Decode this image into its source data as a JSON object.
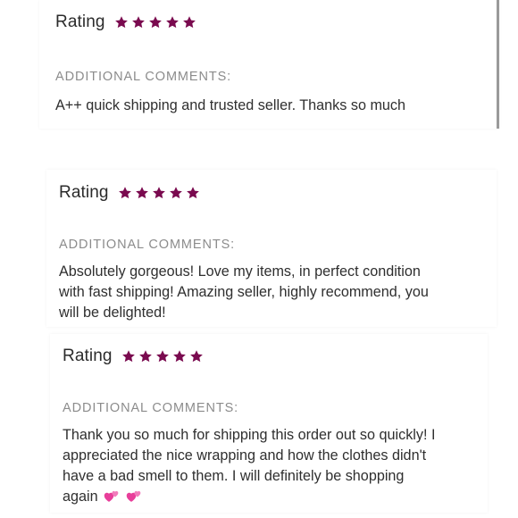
{
  "colors": {
    "star": "#7a0a4f",
    "heart": "#e83e9a",
    "label": "#8c8c8c",
    "text": "#2f2f2f"
  },
  "reviews": [
    {
      "rating_label": "Rating",
      "stars": 5,
      "comments_label": "ADDITIONAL COMMENTS:",
      "comment": "A++ quick shipping and trusted seller. Thanks so much"
    },
    {
      "rating_label": "Rating",
      "stars": 5,
      "comments_label": "ADDITIONAL COMMENTS:",
      "comment_lines": [
        "Absolutely gorgeous! Love my items, in perfect condition",
        "with fast shipping! Amazing seller, highly recommend, you",
        "will be delighted!"
      ]
    },
    {
      "rating_label": "Rating",
      "stars": 5,
      "comments_label": "ADDITIONAL COMMENTS:",
      "comment_lines": [
        "Thank you so much for shipping this order out so quickly! I",
        "appreciated the nice wrapping and how the clothes didn't",
        "have a bad smell to them. I will definitely be shopping",
        "again"
      ],
      "emoji": "two-hearts-icon"
    }
  ]
}
